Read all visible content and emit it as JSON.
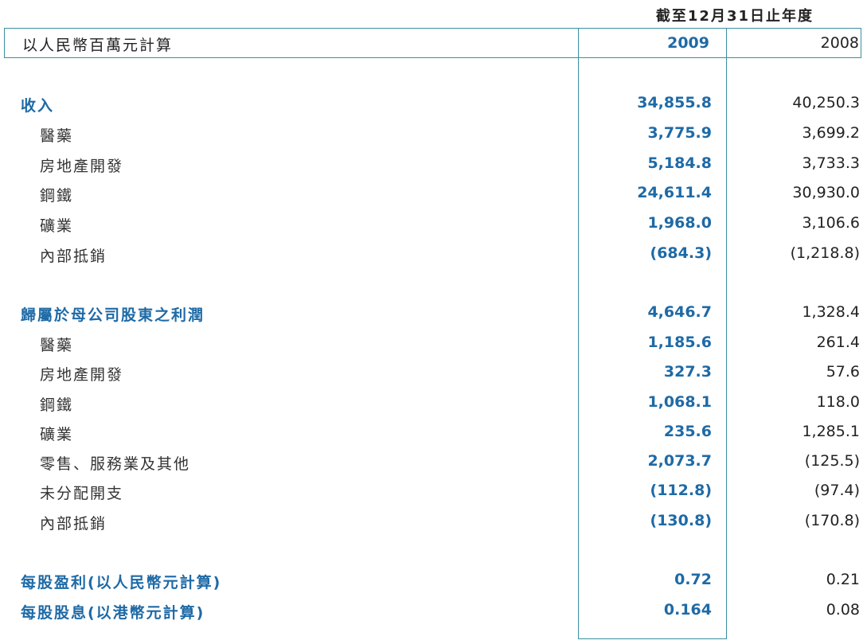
{
  "header": {
    "period_label": "截至12月31日止年度",
    "unit_label": "以人民幣百萬元計算",
    "year_current": "2009",
    "year_prior": "2008"
  },
  "rows": [
    {
      "kind": "section",
      "label": "收入",
      "current": "34,855.8",
      "prior": "40,250.3"
    },
    {
      "kind": "item",
      "label": "醫藥",
      "current": "3,775.9",
      "prior": "3,699.2"
    },
    {
      "kind": "item",
      "label": "房地產開發",
      "current": "5,184.8",
      "prior": "3,733.3"
    },
    {
      "kind": "item",
      "label": "鋼鐵",
      "current": "24,611.4",
      "prior": "30,930.0"
    },
    {
      "kind": "item",
      "label": "礦業",
      "current": "1,968.0",
      "prior": "3,106.6"
    },
    {
      "kind": "item",
      "label": "內部抵銷",
      "current": "(684.3)",
      "prior": "(1,218.8)"
    },
    {
      "kind": "section",
      "label": "歸屬於母公司股東之利潤",
      "current": "4,646.7",
      "prior": "1,328.4"
    },
    {
      "kind": "item",
      "label": "醫藥",
      "current": "1,185.6",
      "prior": "261.4"
    },
    {
      "kind": "item",
      "label": "房地產開發",
      "current": "327.3",
      "prior": "57.6"
    },
    {
      "kind": "item",
      "label": "鋼鐵",
      "current": "1,068.1",
      "prior": "118.0"
    },
    {
      "kind": "item",
      "label": "礦業",
      "current": "235.6",
      "prior": "1,285.1"
    },
    {
      "kind": "item",
      "label": "零售、服務業及其他",
      "current": "2,073.7",
      "prior": "(125.5)"
    },
    {
      "kind": "item",
      "label": "未分配開支",
      "current": "(112.8)",
      "prior": "(97.4)"
    },
    {
      "kind": "item",
      "label": "內部抵銷",
      "current": "(130.8)",
      "prior": "(170.8)"
    },
    {
      "kind": "section",
      "label": "每股盈利(以人民幣元計算)",
      "current": "0.72",
      "prior": "0.21"
    },
    {
      "kind": "section",
      "label": "每股股息(以港幣元計算)",
      "current": "0.164",
      "prior": "0.08"
    }
  ]
}
